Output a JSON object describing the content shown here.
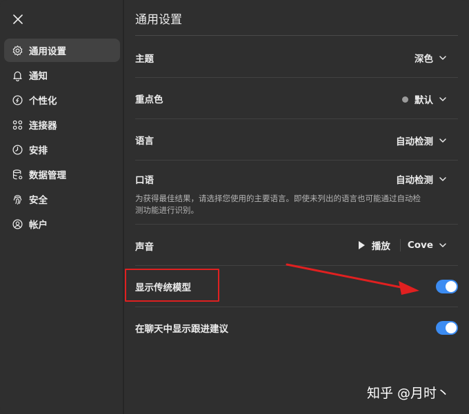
{
  "sidebar": {
    "close_icon": "close-icon",
    "items": [
      {
        "label": "通用设置",
        "icon": "gear-icon",
        "active": true
      },
      {
        "label": "通知",
        "icon": "bell-icon"
      },
      {
        "label": "个性化",
        "icon": "personalize-icon"
      },
      {
        "label": "连接器",
        "icon": "connectors-icon"
      },
      {
        "label": "安排",
        "icon": "clock-icon"
      },
      {
        "label": "数据管理",
        "icon": "database-icon"
      },
      {
        "label": "安全",
        "icon": "fingerprint-icon"
      },
      {
        "label": "帐户",
        "icon": "account-icon"
      }
    ]
  },
  "main": {
    "title": "通用设置",
    "theme": {
      "label": "主题",
      "value": "深色"
    },
    "accent": {
      "label": "重点色",
      "value": "默认",
      "dot_color": "#9b9b9b"
    },
    "language": {
      "label": "语言",
      "value": "自动检测"
    },
    "spoken": {
      "label": "口语",
      "value": "自动检测",
      "hint": "为获得最佳结果，请选择您使用的主要语言。即使未列出的语言也可能通过自动检测功能进行识别。"
    },
    "voice": {
      "label": "声音",
      "play_label": "播放",
      "value": "Cove"
    },
    "legacy_models": {
      "label": "显示传统模型",
      "enabled": true
    },
    "follow_ups": {
      "label": "在聊天中显示跟进建议",
      "enabled": true
    }
  },
  "overlay": {
    "watermark": "知乎 @月时丶",
    "highlight_color": "#e02020",
    "toggle_color": "#3c8cf2"
  }
}
